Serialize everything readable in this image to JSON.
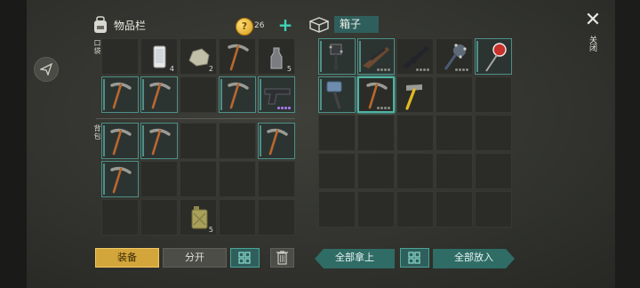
{
  "inventory": {
    "title": "物品栏",
    "coins": "26",
    "pockets_label": "口袋",
    "backpack_label": "背包"
  },
  "box": {
    "title": "箱子"
  },
  "pockets": [
    {
      "icon": "empty"
    },
    {
      "icon": "phone-icon",
      "count": "4"
    },
    {
      "icon": "stone-icon",
      "count": "2"
    },
    {
      "icon": "pickaxe-icon"
    },
    {
      "icon": "bottle-icon",
      "count": "5"
    },
    {
      "icon": "pickaxe-icon",
      "rare": true
    },
    {
      "icon": "pickaxe-icon",
      "rare": true
    },
    {
      "icon": "empty"
    },
    {
      "icon": "pickaxe-icon",
      "rare": true
    },
    {
      "icon": "pistol-icon",
      "rare": true,
      "dots": "purple"
    }
  ],
  "backpack": [
    {
      "icon": "pickaxe-icon",
      "rare": true
    },
    {
      "icon": "pickaxe-icon",
      "rare": true
    },
    {
      "icon": "empty"
    },
    {
      "icon": "empty"
    },
    {
      "icon": "pickaxe-icon",
      "rare": true
    },
    {
      "icon": "pickaxe-icon",
      "rare": true
    },
    {
      "icon": "empty"
    },
    {
      "icon": "empty"
    },
    {
      "icon": "empty"
    },
    {
      "icon": "empty"
    },
    {
      "icon": "empty"
    },
    {
      "icon": "empty"
    },
    {
      "icon": "jerrycan-icon",
      "count": "5"
    },
    {
      "icon": "empty"
    },
    {
      "icon": "empty"
    }
  ],
  "box_items": [
    {
      "icon": "spiked-mace-icon",
      "rare": true
    },
    {
      "icon": "rifle-icon",
      "rare": true,
      "dots": "gray"
    },
    {
      "icon": "assault-rifle-icon",
      "dots": "gray"
    },
    {
      "icon": "spiked-club-icon",
      "dots": "gray"
    },
    {
      "icon": "stop-sign-icon",
      "rare": true
    },
    {
      "icon": "sledgehammer-icon",
      "rare": true
    },
    {
      "icon": "pickaxe-icon",
      "selected": true,
      "dots": "gray"
    },
    {
      "icon": "hammer-icon"
    }
  ],
  "buttons": {
    "equip": "装备",
    "split": "分开",
    "take_all": "全部拿上",
    "put_all": "全部放入",
    "close": "关闭"
  }
}
